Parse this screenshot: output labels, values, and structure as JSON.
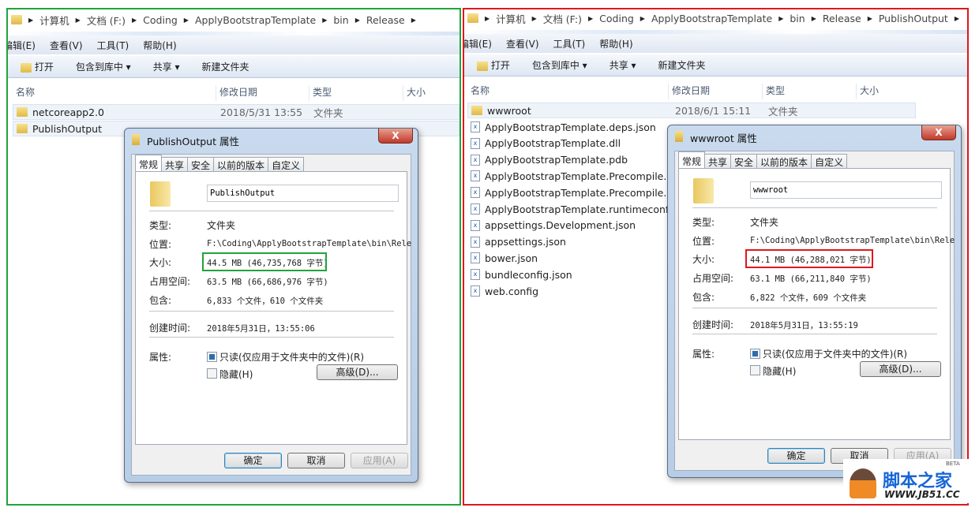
{
  "left": {
    "breadcrumb": [
      "计算机",
      "文档 (F:)",
      "Coding",
      "ApplyBootstrapTemplate",
      "bin",
      "Release"
    ],
    "menu": [
      "编辑(E)",
      "查看(V)",
      "工具(T)",
      "帮助(H)"
    ],
    "toolbar": {
      "open": "打开",
      "include": "包含到库中 ▾",
      "share": "共享 ▾",
      "new_folder": "新建文件夹"
    },
    "columns": {
      "name": "名称",
      "date": "修改日期",
      "type": "类型",
      "size": "大小"
    },
    "files": [
      {
        "name": "netcoreapp2.0",
        "date": "2018/5/31 13:55",
        "type": "文件夹"
      },
      {
        "name": "PublishOutput",
        "date": "",
        "type": ""
      }
    ]
  },
  "right": {
    "breadcrumb": [
      "计算机",
      "文档 (F:)",
      "Coding",
      "ApplyBootstrapTemplate",
      "bin",
      "Release",
      "PublishOutput"
    ],
    "menu": [
      "编辑(E)",
      "查看(V)",
      "工具(T)",
      "帮助(H)"
    ],
    "toolbar": {
      "open": "打开",
      "include": "包含到库中 ▾",
      "share": "共享 ▾",
      "new_folder": "新建文件夹"
    },
    "columns": {
      "name": "名称",
      "date": "修改日期",
      "type": "类型",
      "size": "大小"
    },
    "files": [
      {
        "name": "wwwroot",
        "date": "2018/6/1 15:11",
        "type": "文件夹"
      },
      {
        "name": "ApplyBootstrapTemplate.deps.json"
      },
      {
        "name": "ApplyBootstrapTemplate.dll"
      },
      {
        "name": "ApplyBootstrapTemplate.pdb"
      },
      {
        "name": "ApplyBootstrapTemplate.Precompile..."
      },
      {
        "name": "ApplyBootstrapTemplate.Precompile..."
      },
      {
        "name": "ApplyBootstrapTemplate.runtimeconf..."
      },
      {
        "name": "appsettings.Development.json"
      },
      {
        "name": "appsettings.json"
      },
      {
        "name": "bower.json"
      },
      {
        "name": "bundleconfig.json"
      },
      {
        "name": "web.config"
      }
    ]
  },
  "dlgL": {
    "title": "PublishOutput 属性",
    "close": "X",
    "tabs": [
      "常规",
      "共享",
      "安全",
      "以前的版本",
      "自定义"
    ],
    "name": "PublishOutput",
    "labels": {
      "type": "类型:",
      "location": "位置:",
      "size": "大小:",
      "disk": "占用空间:",
      "contains": "包含:",
      "created": "创建时间:",
      "attrs": "属性:"
    },
    "type": "文件夹",
    "location": "F:\\Coding\\ApplyBootstrapTemplate\\bin\\Rele",
    "size": "44.5 MB (46,735,768 字节)",
    "disk": "63.5 MB (66,686,976 字节)",
    "contains": "6,833 个文件，610 个文件夹",
    "created": "2018年5月31日，13:55:06",
    "readonly": "只读(仅应用于文件夹中的文件)(R)",
    "hidden": "隐藏(H)",
    "advanced": "高级(D)...",
    "ok": "确定",
    "cancel": "取消",
    "apply": "应用(A)",
    "highlight": "#22a33a"
  },
  "dlgR": {
    "title": "wwwroot 属性",
    "close": "X",
    "tabs": [
      "常规",
      "共享",
      "安全",
      "以前的版本",
      "自定义"
    ],
    "name": "wwwroot",
    "labels": {
      "type": "类型:",
      "location": "位置:",
      "size": "大小:",
      "disk": "占用空间:",
      "contains": "包含:",
      "created": "创建时间:",
      "attrs": "属性:"
    },
    "type": "文件夹",
    "location": "F:\\Coding\\ApplyBootstrapTemplate\\bin\\Rele",
    "size": "44.1 MB (46,288,021 字节)",
    "disk": "63.1 MB (66,211,840 字节)",
    "contains": "6,822 个文件，609 个文件夹",
    "created": "2018年5月31日，13:55:19",
    "readonly": "只读(仅应用于文件夹中的文件)(R)",
    "hidden": "隐藏(H)",
    "advanced": "高级(D)...",
    "ok": "确定",
    "cancel": "取消",
    "apply": "应用(A)",
    "highlight": "#e0161e"
  },
  "watermark": {
    "brand": "脚本之家",
    "url": "WWW.JB51.CC",
    "beta": "BETA"
  }
}
